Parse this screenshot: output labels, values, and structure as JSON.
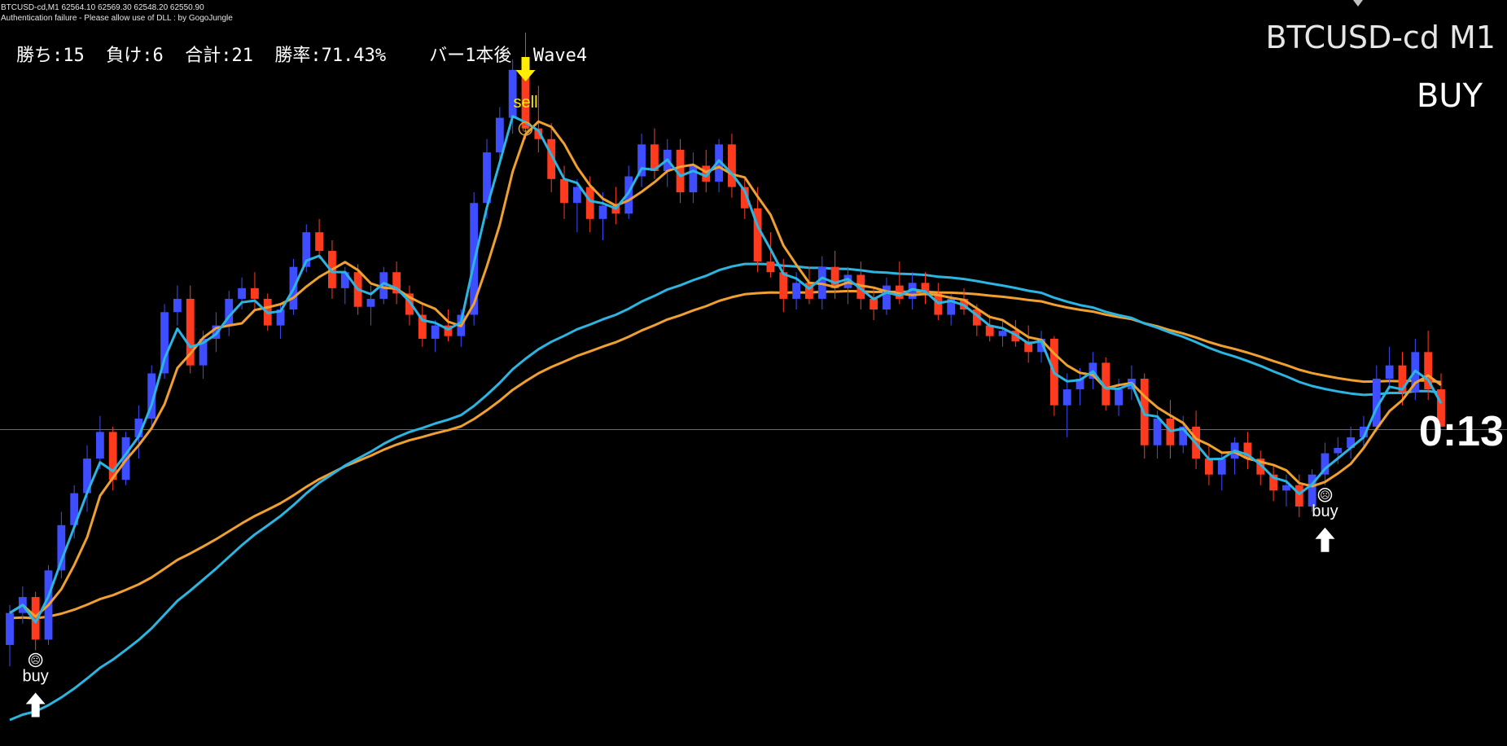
{
  "header": {
    "symbol_line": "BTCUSD-cd,M1  62564.10 62569.30 62548.20 62550.90",
    "auth_line": "Authentication failure - Please allow use of DLL : by GogoJungle"
  },
  "stats": {
    "text": "勝ち:15  負け:6  合計:21  勝率:71.43%    バー1本後  Wave4"
  },
  "symbol_title": "BTCUSD-cd M1",
  "signal": "BUY",
  "countdown": "0:13",
  "colors": {
    "background": "#000000",
    "bull_candle": "#3d4dff",
    "bear_candle": "#ff3b1f",
    "fast_ma_blue": "#2bb5e0",
    "ma_orange": "#f0a030",
    "price_line": "#5a6e80",
    "sell_arrow": "#ffee00",
    "buy_arrow": "#ffffff"
  },
  "chart_data": {
    "type": "candlestick",
    "timeframe": "M1",
    "price_range": [
      62440,
      62700
    ],
    "current_price": 62550.9,
    "candles": [
      [
        62470,
        62485,
        62462,
        62482
      ],
      [
        62482,
        62492,
        62478,
        62488
      ],
      [
        62488,
        62490,
        62468,
        62472
      ],
      [
        62472,
        62500,
        62470,
        62498
      ],
      [
        62498,
        62520,
        62495,
        62515
      ],
      [
        62515,
        62530,
        62510,
        62527
      ],
      [
        62527,
        62545,
        62520,
        62540
      ],
      [
        62540,
        62556,
        62536,
        62550
      ],
      [
        62550,
        62552,
        62528,
        62532
      ],
      [
        62532,
        62550,
        62530,
        62548
      ],
      [
        62548,
        62560,
        62540,
        62555
      ],
      [
        62555,
        62575,
        62552,
        62572
      ],
      [
        62572,
        62598,
        62570,
        62595
      ],
      [
        62595,
        62605,
        62590,
        62600
      ],
      [
        62600,
        62605,
        62572,
        62575
      ],
      [
        62575,
        62588,
        62570,
        62585
      ],
      [
        62585,
        62595,
        62580,
        62590
      ],
      [
        62590,
        62603,
        62586,
        62600
      ],
      [
        62600,
        62608,
        62596,
        62604
      ],
      [
        62604,
        62610,
        62596,
        62600
      ],
      [
        62600,
        62602,
        62588,
        62590
      ],
      [
        62590,
        62598,
        62585,
        62596
      ],
      [
        62596,
        62615,
        62594,
        62612
      ],
      [
        62612,
        62628,
        62610,
        62625
      ],
      [
        62625,
        62630,
        62615,
        62618
      ],
      [
        62618,
        62622,
        62600,
        62604
      ],
      [
        62604,
        62612,
        62598,
        62610
      ],
      [
        62610,
        62613,
        62594,
        62597
      ],
      [
        62597,
        62605,
        62590,
        62600
      ],
      [
        62600,
        62612,
        62598,
        62610
      ],
      [
        62610,
        62614,
        62598,
        62602
      ],
      [
        62602,
        62605,
        62590,
        62594
      ],
      [
        62594,
        62598,
        62582,
        62585
      ],
      [
        62585,
        62592,
        62580,
        62590
      ],
      [
        62590,
        62596,
        62584,
        62586
      ],
      [
        62586,
        62596,
        62582,
        62594
      ],
      [
        62594,
        62640,
        62590,
        62636
      ],
      [
        62636,
        62660,
        62630,
        62655
      ],
      [
        62655,
        62672,
        62650,
        62668
      ],
      [
        62668,
        62690,
        62662,
        62686
      ],
      [
        62686,
        62700,
        62660,
        62664
      ],
      [
        62664,
        62680,
        62655,
        62660
      ],
      [
        62660,
        62666,
        62640,
        62645
      ],
      [
        62645,
        62650,
        62630,
        62636
      ],
      [
        62636,
        62645,
        62625,
        62642
      ],
      [
        62642,
        62646,
        62625,
        62630
      ],
      [
        62630,
        62640,
        62622,
        62635
      ],
      [
        62635,
        62642,
        62628,
        62632
      ],
      [
        62632,
        62650,
        62630,
        62646
      ],
      [
        62646,
        62662,
        62642,
        62658
      ],
      [
        62658,
        62664,
        62645,
        62648
      ],
      [
        62648,
        62660,
        62642,
        62656
      ],
      [
        62656,
        62660,
        62636,
        62640
      ],
      [
        62640,
        62655,
        62636,
        62650
      ],
      [
        62650,
        62656,
        62640,
        62644
      ],
      [
        62644,
        62660,
        62640,
        62658
      ],
      [
        62658,
        62662,
        62638,
        62642
      ],
      [
        62642,
        62646,
        62630,
        62634
      ],
      [
        62634,
        62642,
        62610,
        62614
      ],
      [
        62614,
        62625,
        62608,
        62610
      ],
      [
        62610,
        62615,
        62595,
        62600
      ],
      [
        62600,
        62610,
        62596,
        62606
      ],
      [
        62606,
        62612,
        62598,
        62600
      ],
      [
        62600,
        62616,
        62596,
        62612
      ],
      [
        62612,
        62618,
        62600,
        62604
      ],
      [
        62604,
        62612,
        62598,
        62609
      ],
      [
        62609,
        62614,
        62596,
        62600
      ],
      [
        62600,
        62604,
        62592,
        62596
      ],
      [
        62596,
        62608,
        62594,
        62605
      ],
      [
        62605,
        62614,
        62598,
        62600
      ],
      [
        62600,
        62610,
        62596,
        62606
      ],
      [
        62606,
        62610,
        62598,
        62602
      ],
      [
        62602,
        62606,
        62592,
        62594
      ],
      [
        62594,
        62602,
        62590,
        62600
      ],
      [
        62600,
        62604,
        62594,
        62596
      ],
      [
        62596,
        62598,
        62586,
        62590
      ],
      [
        62590,
        62594,
        62584,
        62586
      ],
      [
        62586,
        62592,
        62582,
        62588
      ],
      [
        62588,
        62592,
        62582,
        62584
      ],
      [
        62584,
        62590,
        62576,
        62580
      ],
      [
        62580,
        62588,
        62576,
        62585
      ],
      [
        62585,
        62586,
        62556,
        62560
      ],
      [
        62560,
        62572,
        62548,
        62566
      ],
      [
        62566,
        62574,
        62560,
        62570
      ],
      [
        62570,
        62580,
        62566,
        62576
      ],
      [
        62576,
        62578,
        62558,
        62560
      ],
      [
        62560,
        62570,
        62556,
        62566
      ],
      [
        62566,
        62575,
        62562,
        62570
      ],
      [
        62570,
        62572,
        62540,
        62545
      ],
      [
        62545,
        62558,
        62540,
        62555
      ],
      [
        62555,
        62562,
        62540,
        62545
      ],
      [
        62545,
        62556,
        62542,
        62552
      ],
      [
        62552,
        62558,
        62536,
        62540
      ],
      [
        62540,
        62545,
        62530,
        62534
      ],
      [
        62534,
        62542,
        62528,
        62540
      ],
      [
        62540,
        62548,
        62534,
        62546
      ],
      [
        62546,
        62550,
        62536,
        62540
      ],
      [
        62540,
        62543,
        62530,
        62534
      ],
      [
        62534,
        62538,
        62524,
        62528
      ],
      [
        62528,
        62534,
        62522,
        62530
      ],
      [
        62530,
        62534,
        62518,
        62522
      ],
      [
        62522,
        62536,
        62520,
        62534
      ],
      [
        62534,
        62546,
        62530,
        62542
      ],
      [
        62542,
        62548,
        62538,
        62544
      ],
      [
        62544,
        62552,
        62540,
        62548
      ],
      [
        62548,
        62556,
        62544,
        62552
      ],
      [
        62552,
        62575,
        62550,
        62570
      ],
      [
        62570,
        62582,
        62566,
        62575
      ],
      [
        62575,
        62580,
        62560,
        62565
      ],
      [
        62565,
        62585,
        62562,
        62580
      ],
      [
        62580,
        62588,
        62562,
        62566
      ],
      [
        62566,
        62572,
        62556,
        62552
      ]
    ],
    "indicators": [
      {
        "name": "fast_ma",
        "color": "#2bb5e0"
      },
      {
        "name": "mid_ma",
        "color": "#f0a030"
      },
      {
        "name": "slow_ma_blue",
        "color": "#2bb5e0"
      },
      {
        "name": "slow_ma_orange",
        "color": "#f0a030"
      }
    ],
    "signals": [
      {
        "type": "buy",
        "label": "buy",
        "face": "☹",
        "candle_index": 2
      },
      {
        "type": "sell",
        "label": "sell",
        "face": "☺",
        "candle_index": 40
      },
      {
        "type": "buy",
        "label": "buy",
        "face": "☹",
        "candle_index": 102
      }
    ]
  }
}
